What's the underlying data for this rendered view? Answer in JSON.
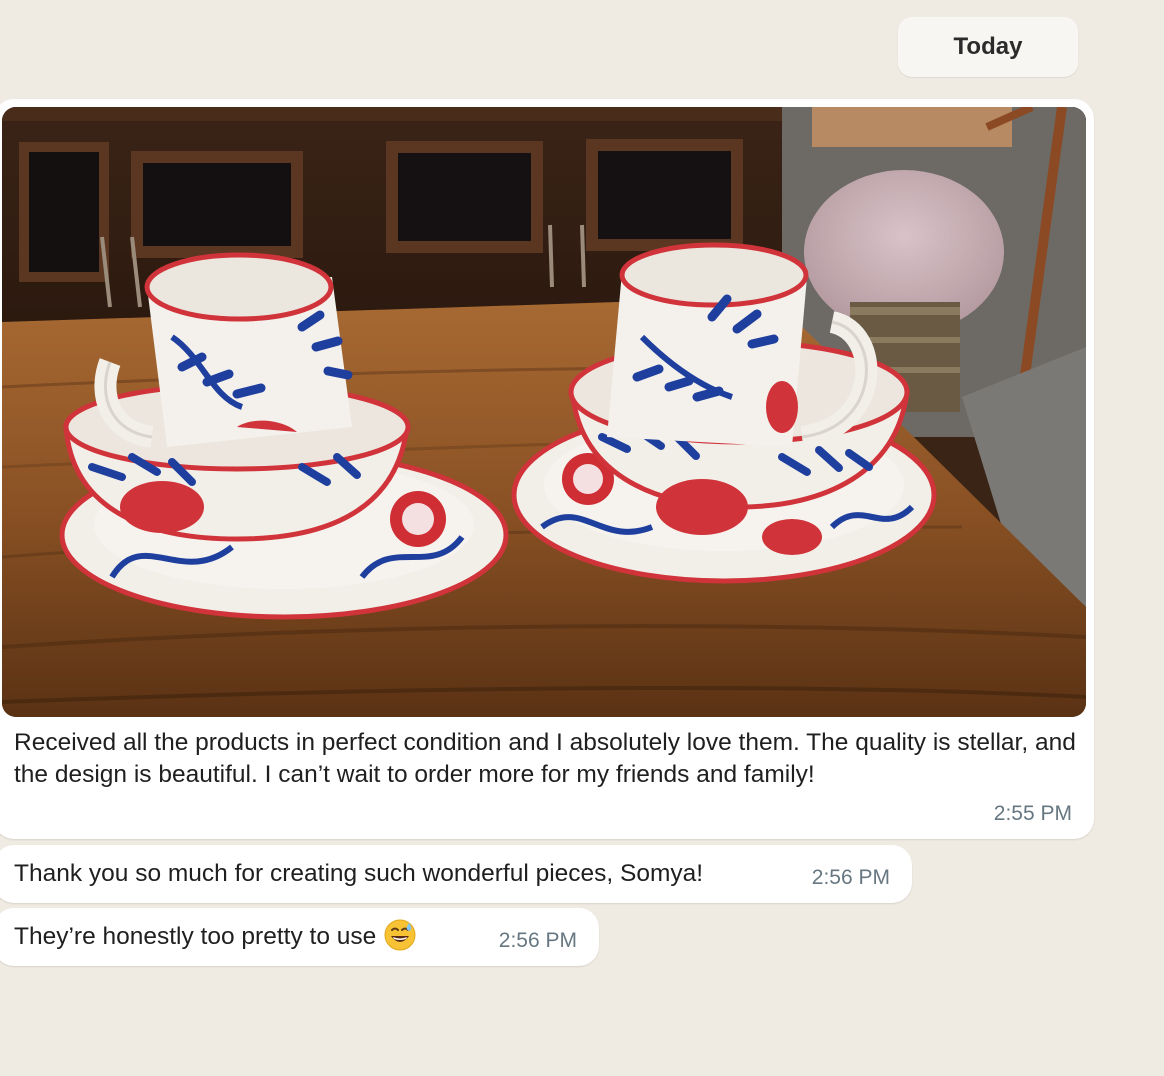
{
  "date_separator": {
    "label": "Today"
  },
  "messages": [
    {
      "type": "image",
      "image": {
        "alt": "Blue and red floral ceramic mugs, bowls and plates on a wooden table"
      },
      "caption": "Received all the products in perfect condition and I absolutely love them. The quality is stellar, and the design is beautiful. I can’t wait to order more for my friends and family!",
      "time": "2:55 PM"
    },
    {
      "type": "text",
      "text": "Thank you so much for creating such wonderful pieces, Somya!",
      "time": "2:56 PM"
    },
    {
      "type": "text",
      "text": "They’re honestly too pretty to use",
      "emoji": "grinning-face-with-sweat-icon",
      "time": "2:56 PM"
    }
  ],
  "colors": {
    "wallpaper": "#efeae2",
    "bubble": "#ffffff",
    "timestamp": "#667781",
    "ceramic_blue": "#1f3f9e",
    "ceramic_red": "#d6343a"
  }
}
